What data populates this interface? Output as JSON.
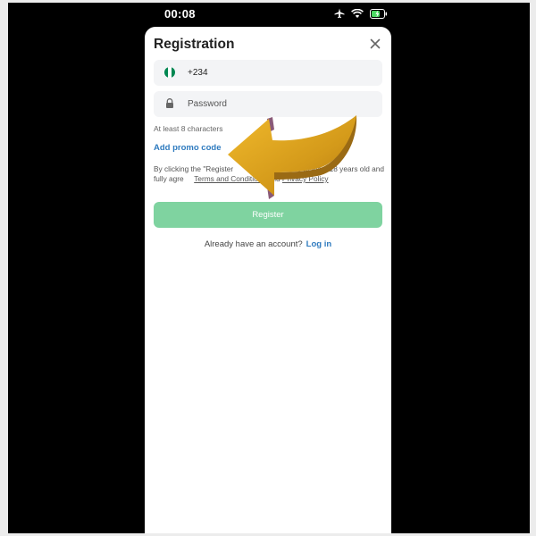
{
  "status_bar": {
    "time": "00:08",
    "icons": [
      "airplane-icon",
      "wifi-icon",
      "battery-charging-icon"
    ]
  },
  "registration": {
    "title": "Registration",
    "phone": {
      "flag_colors": [
        "#008751",
        "#ffffff",
        "#008751"
      ],
      "value": "+234"
    },
    "password": {
      "placeholder": "Password",
      "icon": "lock-icon"
    },
    "password_hint": "At least 8 characters",
    "promo_link": "Add promo code",
    "terms": {
      "prefix": "By clicking the \"Register",
      "middle": "t you are at least 18 years old and fully agre",
      "terms_link": "Terms and Conditions",
      "and": "and",
      "privacy_link": "Privacy Policy"
    },
    "register_button": "Register",
    "login": {
      "text": "Already have an account?",
      "link": "Log in"
    }
  },
  "colors": {
    "accent_green": "#7fd3a0",
    "link_blue": "#2f7bbf",
    "arrow_gold": "#d6a020"
  }
}
